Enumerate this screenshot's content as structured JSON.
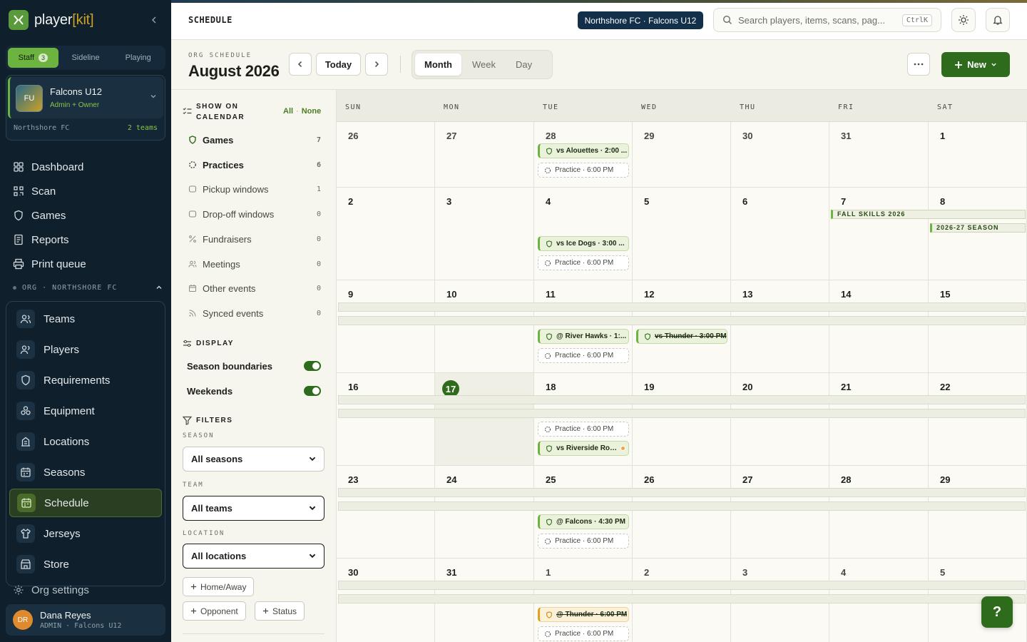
{
  "brand": {
    "name_prefix": "player",
    "name_bracket_open": "[",
    "name_core": "kit",
    "name_bracket_close": "]"
  },
  "mode_tabs": [
    {
      "label": "Staff",
      "badge": "3"
    },
    {
      "label": "Sideline"
    },
    {
      "label": "Playing"
    }
  ],
  "team_switcher": {
    "initials": "FU",
    "name": "Falcons U12",
    "role": "Admin + Owner",
    "org": "Northshore FC",
    "count": "2 teams"
  },
  "nav": [
    {
      "label": "Dashboard",
      "icon": "dashboard-icon"
    },
    {
      "label": "Scan",
      "icon": "scan-icon"
    },
    {
      "label": "Games",
      "icon": "shield-icon"
    },
    {
      "label": "Reports",
      "icon": "reports-icon"
    },
    {
      "label": "Print queue",
      "icon": "printer-icon"
    }
  ],
  "org_section": {
    "label": "ORG · NORTHSHORE FC"
  },
  "org_nav": [
    {
      "label": "Teams",
      "icon": "users-icon"
    },
    {
      "label": "Players",
      "icon": "user-icon"
    },
    {
      "label": "Requirements",
      "icon": "shield-check-icon"
    },
    {
      "label": "Equipment",
      "icon": "equipment-icon"
    },
    {
      "label": "Locations",
      "icon": "building-icon"
    },
    {
      "label": "Seasons",
      "icon": "calendar-icon"
    },
    {
      "label": "Schedule",
      "icon": "calendar-icon",
      "active": true
    },
    {
      "label": "Jerseys",
      "icon": "shirt-icon"
    },
    {
      "label": "Store",
      "icon": "store-icon"
    }
  ],
  "org_settings": {
    "label": "Org settings"
  },
  "user": {
    "initials": "DR",
    "name": "Dana Reyes",
    "role": "ADMIN · Falcons U12"
  },
  "topbar": {
    "breadcrumb": "SCHEDULE",
    "org_pill": "Northshore FC · Falcons U12",
    "search_placeholder": "Search players, items, scans, pag...",
    "search_shortcut": "CtrlK"
  },
  "header": {
    "eyebrow": "ORG SCHEDULE",
    "title": "August 2026",
    "today_label": "Today",
    "views": [
      "Month",
      "Week",
      "Day"
    ],
    "active_view": "Month",
    "new_label": "New"
  },
  "filters": {
    "show_title": "SHOW ON CALENDAR",
    "all_label": "All",
    "separator": "·",
    "none_label": "None",
    "categories": [
      {
        "label": "Games",
        "count": "7",
        "on": true,
        "icon": "shield-icon"
      },
      {
        "label": "Practices",
        "count": "6",
        "on": true,
        "icon": "practice-icon"
      },
      {
        "label": "Pickup windows",
        "count": "1",
        "on": false,
        "icon": "box-icon"
      },
      {
        "label": "Drop-off windows",
        "count": "0",
        "on": false,
        "icon": "box-icon"
      },
      {
        "label": "Fundraisers",
        "count": "0",
        "on": false,
        "icon": "percent-icon"
      },
      {
        "label": "Meetings",
        "count": "0",
        "on": false,
        "icon": "people-icon"
      },
      {
        "label": "Other events",
        "count": "0",
        "on": false,
        "icon": "calendar-icon"
      },
      {
        "label": "Synced events",
        "count": "0",
        "on": false,
        "icon": "rss-icon"
      }
    ],
    "display_title": "DISPLAY",
    "display_toggles": [
      {
        "label": "Season boundaries",
        "on": true
      },
      {
        "label": "Weekends",
        "on": true
      }
    ],
    "filters_title": "FILTERS",
    "season_label": "SEASON",
    "season_value": "All seasons",
    "team_label": "TEAM",
    "team_value": "All teams",
    "location_label": "LOCATION",
    "location_value": "All locations",
    "chips": [
      "Home/Away",
      "Opponent",
      "Status"
    ]
  },
  "calendar": {
    "weekdays": [
      "SUN",
      "MON",
      "TUE",
      "WED",
      "THU",
      "FRI",
      "SAT"
    ],
    "weeks": [
      [
        "26",
        "27",
        "28",
        "29",
        "30",
        "31",
        "1"
      ],
      [
        "2",
        "3",
        "4",
        "5",
        "6",
        "7",
        "8"
      ],
      [
        "9",
        "10",
        "11",
        "12",
        "13",
        "14",
        "15"
      ],
      [
        "16",
        "17",
        "18",
        "19",
        "20",
        "21",
        "22"
      ],
      [
        "23",
        "24",
        "25",
        "26",
        "27",
        "28",
        "29"
      ],
      [
        "30",
        "31",
        "1",
        "2",
        "3",
        "4",
        "5"
      ]
    ],
    "today": "17",
    "season_labels": [
      "FALL SKILLS 2026",
      "2026-27 SEASON"
    ],
    "events": [
      {
        "label": "vs Alouettes · 2:00 ...",
        "kind": "game"
      },
      {
        "label": "Practice · 6:00 PM",
        "kind": "practice"
      },
      {
        "label": "vs Ice Dogs · 3:00 ...",
        "kind": "game"
      },
      {
        "label": "Practice · 6:00 PM",
        "kind": "practice"
      },
      {
        "label": "@ River Hawks · 1:...",
        "kind": "game"
      },
      {
        "label": "Practice · 6:00 PM",
        "kind": "practice"
      },
      {
        "label": "vs Thunder · 3:00 PM",
        "kind": "game",
        "cancelled": true
      },
      {
        "label": "Practice · 6:00 PM",
        "kind": "practice"
      },
      {
        "label": "vs Riverside Rov...",
        "kind": "game",
        "flag": true
      },
      {
        "label": "@ Falcons · 4:30 PM",
        "kind": "game"
      },
      {
        "label": "Practice · 6:00 PM",
        "kind": "practice"
      },
      {
        "label": "@ Thunder · 6:00 PM",
        "kind": "game",
        "cancelled": true,
        "away": true
      },
      {
        "label": "Practice · 6:00 PM",
        "kind": "practice"
      }
    ]
  },
  "help_label": "?"
}
